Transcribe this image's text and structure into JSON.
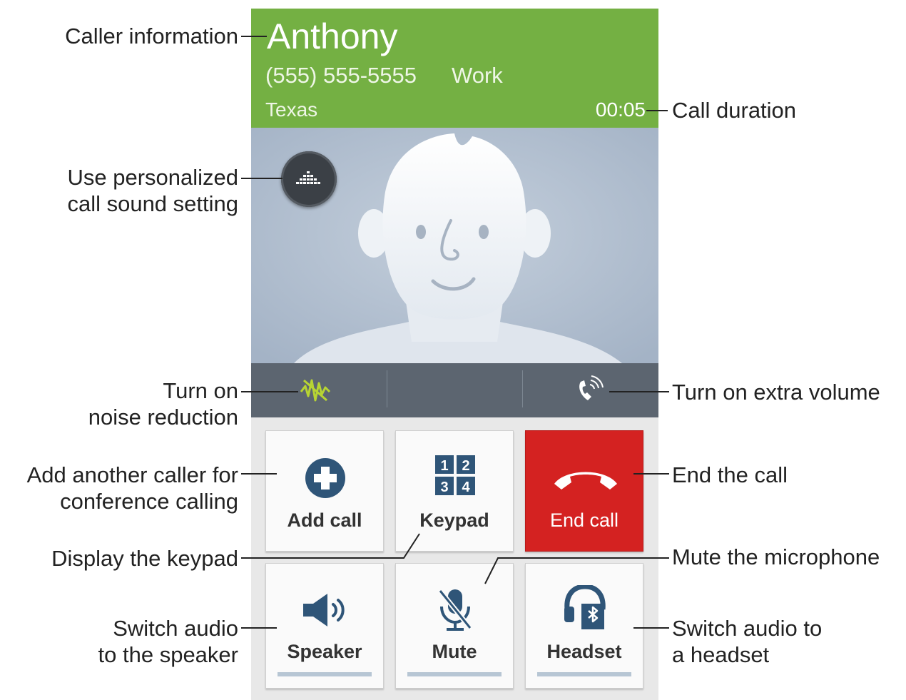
{
  "caller": {
    "name": "Anthony",
    "number": "(555) 555-5555",
    "label": "Work",
    "location": "Texas",
    "duration": "00:05"
  },
  "buttons": {
    "add_call": "Add call",
    "keypad": "Keypad",
    "keypad_digits": [
      "1",
      "2",
      "3",
      "4"
    ],
    "end_call": "End call",
    "speaker": "Speaker",
    "mute": "Mute",
    "headset": "Headset"
  },
  "icons": {
    "sound_setting": "equalizer-icon",
    "noise_reduction": "noise-reduction-icon",
    "extra_volume": "extra-volume-icon",
    "add_call": "plus-circle-icon",
    "keypad": "keypad-icon",
    "end_call": "phone-hangup-icon",
    "speaker": "speaker-icon",
    "mute": "microphone-muted-icon",
    "headset": "bluetooth-headset-icon"
  },
  "callouts": {
    "caller_information": "Caller information",
    "call_duration": "Call duration",
    "sound_setting": [
      "Use personalized",
      "call sound setting"
    ],
    "noise_reduction": [
      "Turn on",
      "noise reduction"
    ],
    "extra_volume": "Turn on extra volume",
    "add_caller": [
      "Add another caller for",
      "conference calling"
    ],
    "end_call": "End the call",
    "display_keypad": "Display the keypad",
    "mute_microphone": "Mute the microphone",
    "switch_speaker": [
      "Switch audio",
      "to the speaker"
    ],
    "switch_headset": [
      "Switch audio to",
      "a headset"
    ]
  },
  "colors": {
    "header_green": "#74b043",
    "end_call_red": "#d42221",
    "icon_blue": "#2f5578",
    "control_bar": "#5c6570",
    "noise_icon_green": "#b7d433"
  }
}
